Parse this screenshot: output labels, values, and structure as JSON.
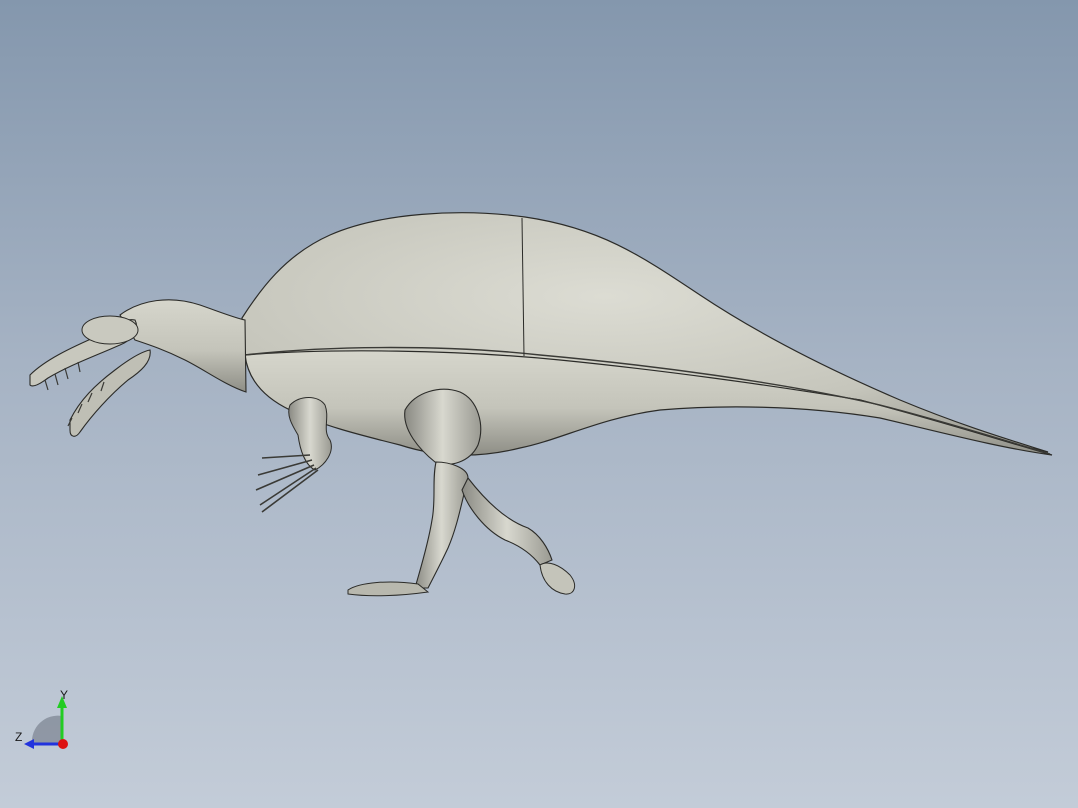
{
  "viewport": {
    "background_top": "#8497ad",
    "background_bottom": "#c3ccd8",
    "model_fill": "#c9c9c0",
    "model_edge": "#2b2b28"
  },
  "triad": {
    "y_label": "Y",
    "z_label": "Z",
    "y_color": "#22cc22",
    "z_color": "#2233dd",
    "x_color": "#dd1111",
    "icon": "view-orientation-triad-icon"
  }
}
